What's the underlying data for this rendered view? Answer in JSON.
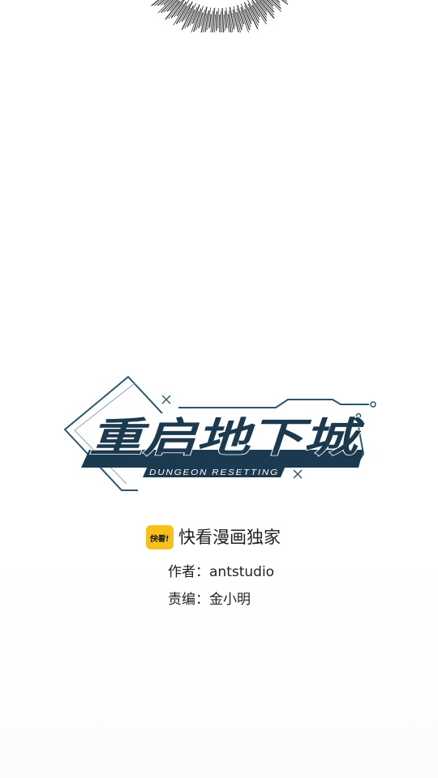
{
  "logo": {
    "title": "重启地下城",
    "subtitle": "DUNGEON RESETTING"
  },
  "platform": {
    "badge_text": "快看!",
    "exclusive_label": "快看漫画独家"
  },
  "credits": {
    "author_label": "作者：",
    "author_value": "antstudio",
    "editor_label": "责编：",
    "editor_value": "金小明"
  },
  "colors": {
    "logo_dark": "#1c3a4f",
    "logo_accent": "#2a5670",
    "badge_yellow": "#f6c21a",
    "text": "#222222"
  }
}
